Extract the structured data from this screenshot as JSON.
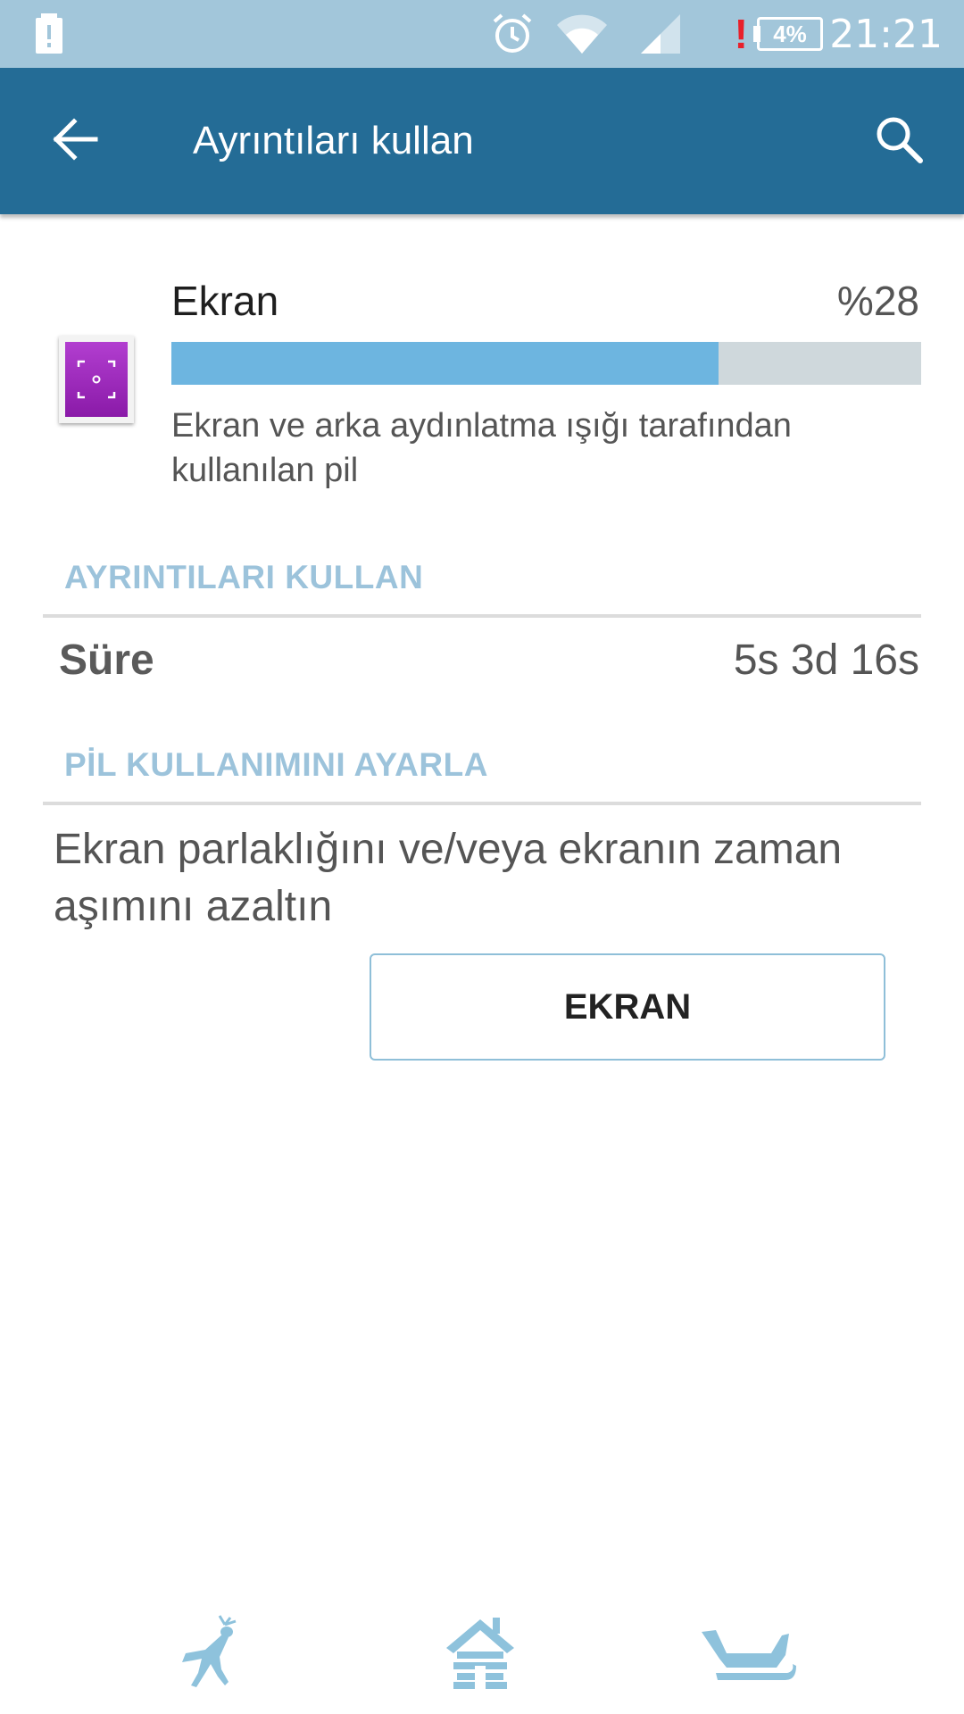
{
  "status_bar": {
    "time": "21:21",
    "battery_percent": "4%",
    "icons": [
      "battery-alert-icon",
      "alarm-icon",
      "wifi-icon",
      "signal-icon",
      "warning-icon",
      "battery-icon"
    ]
  },
  "app_bar": {
    "title": "Ayrıntıları kullan",
    "back_icon": "arrow-left-icon",
    "search_icon": "search-icon",
    "color": "#246c96"
  },
  "usage_item": {
    "name": "Ekran",
    "percent_label": "%28",
    "percent_value": 28,
    "bar_fill_fraction": 0.73,
    "description": "Ekran ve arka aydınlatma ışığı tarafından kullanılan pil",
    "icon": "screen-icon"
  },
  "details_section": {
    "title": "AYRINTILARI KULLAN",
    "rows": [
      {
        "label": "Süre",
        "value": "5s 3d 16s"
      }
    ]
  },
  "adjust_section": {
    "title": "PİL KULLANIMINI AYARLA",
    "tip": "Ekran parlaklığını ve/veya ekranın zaman aşımını azaltın",
    "button_label": "EKRAN"
  },
  "bottom_decorations": [
    "reindeer-icon",
    "house-icon",
    "sleigh-icon"
  ],
  "colors": {
    "status_bar": "#a2c6da",
    "accent": "#6db5e0",
    "section_header": "#9cc3db"
  }
}
